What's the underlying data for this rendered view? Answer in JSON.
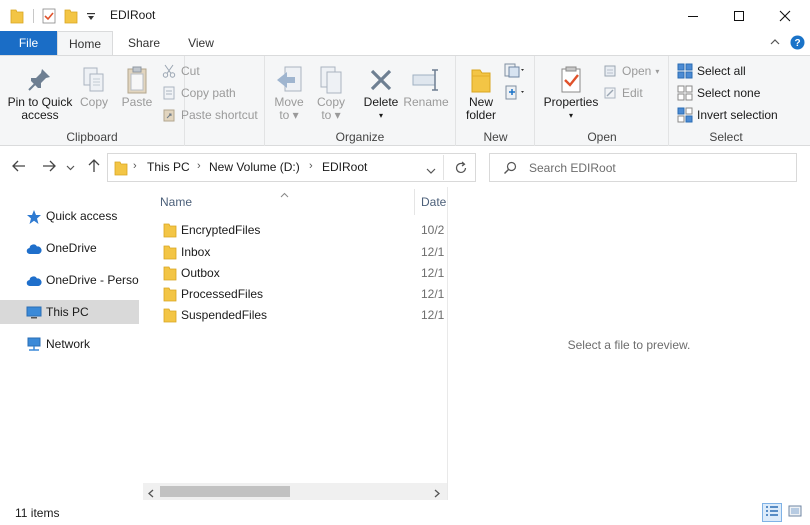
{
  "window": {
    "title": "EDIRoot",
    "controls": [
      "minimize",
      "maximize",
      "close"
    ]
  },
  "ribbon": {
    "tabs": [
      "File",
      "Home",
      "Share",
      "View"
    ],
    "active_tab": "Home",
    "groups": {
      "clipboard": {
        "label": "Clipboard",
        "pin_label": "Pin to Quick access",
        "pin_line1": "Pin to Quick",
        "pin_line2": "access",
        "copy": "Copy",
        "paste": "Paste",
        "cut": "Cut",
        "copy_path": "Copy path",
        "paste_shortcut": "Paste shortcut"
      },
      "organize": {
        "label": "Organize",
        "move_to_line1": "Move",
        "move_to_line2": "to",
        "copy_to_line1": "Copy",
        "copy_to_line2": "to",
        "delete": "Delete",
        "rename": "Rename"
      },
      "new": {
        "label": "New",
        "new_folder_line1": "New",
        "new_folder_line2": "folder"
      },
      "open": {
        "label": "Open",
        "properties": "Properties",
        "open": "Open",
        "edit": "Edit"
      },
      "select": {
        "label": "Select",
        "select_all": "Select all",
        "select_none": "Select none",
        "invert_selection": "Invert selection"
      }
    }
  },
  "address": {
    "breadcrumbs": [
      "This PC",
      "New Volume (D:)",
      "EDIRoot"
    ]
  },
  "search": {
    "placeholder": "Search EDIRoot"
  },
  "nav_pane": {
    "items": [
      {
        "label": "Quick access",
        "icon": "star-icon"
      },
      {
        "label": "OneDrive",
        "icon": "cloud-icon"
      },
      {
        "label": "OneDrive - Persor",
        "icon": "cloud-icon"
      },
      {
        "label": "This PC",
        "icon": "monitor-icon",
        "selected": true
      },
      {
        "label": "Network",
        "icon": "network-icon"
      }
    ]
  },
  "file_list": {
    "columns": [
      "Name",
      "Date"
    ],
    "rows": [
      {
        "name": "EncryptedFiles",
        "date": "10/2"
      },
      {
        "name": "Inbox",
        "date": "12/1"
      },
      {
        "name": "Outbox",
        "date": "12/1"
      },
      {
        "name": "ProcessedFiles",
        "date": "12/1"
      },
      {
        "name": "SuspendedFiles",
        "date": "12/1"
      }
    ]
  },
  "preview": {
    "message": "Select a file to preview."
  },
  "status": {
    "item_count": "11 items"
  },
  "colors": {
    "file_tab": "#1a6dc6",
    "folder_yellow": "#f3c545",
    "accent_blue": "#1a73c8"
  }
}
